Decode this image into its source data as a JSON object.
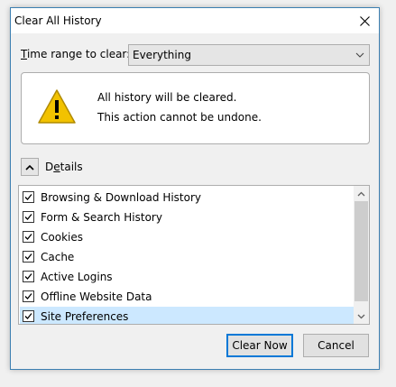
{
  "window": {
    "title": "Clear All History"
  },
  "time_range": {
    "label_underlined": "T",
    "label_rest": "ime range to clear:",
    "selected": "Everything"
  },
  "warning": {
    "line1": "All history will be cleared.",
    "line2": "This action cannot be undone."
  },
  "details": {
    "label_underlined": "e",
    "label_pre": "D",
    "label_rest": "tails",
    "expanded": true
  },
  "items": [
    {
      "label": "Browsing & Download History",
      "checked": true
    },
    {
      "label": "Form & Search History",
      "checked": true
    },
    {
      "label": "Cookies",
      "checked": true
    },
    {
      "label": "Cache",
      "checked": true
    },
    {
      "label": "Active Logins",
      "checked": true
    },
    {
      "label": "Offline Website Data",
      "checked": true
    },
    {
      "label": "Site Preferences",
      "checked": true,
      "selected": true
    }
  ],
  "buttons": {
    "clear": "Clear Now",
    "cancel": "Cancel"
  },
  "colors": {
    "accent": "#0078d7",
    "selection": "#cce8ff",
    "warning": "#f2c200"
  }
}
